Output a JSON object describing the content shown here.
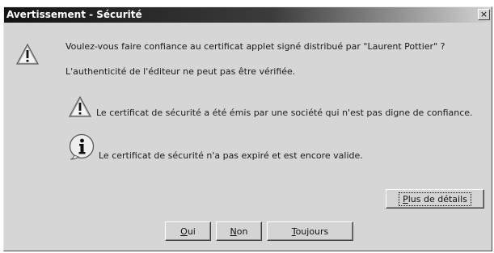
{
  "dialog": {
    "title": "Avertissement - Sécurité",
    "close_glyph": "×",
    "question": "Voulez-vous faire confiance au certificat applet signé distribué par \"Laurent Pottier\" ?",
    "publisher_warning": "L'authenticité de l'éditeur ne peut pas être vérifiée.",
    "untrusted_issuer": "Le certificat de sécurité a été émis par une société qui n'est pas digne de confiance.",
    "valid_certificate": "Le certificat de sécurité n'a pas expiré et est encore valide."
  },
  "buttons": {
    "details": {
      "mnemonic": "P",
      "rest": "lus de détails"
    },
    "yes": {
      "mnemonic": "O",
      "rest": "ui"
    },
    "no": {
      "mnemonic": "N",
      "rest": "on"
    },
    "always": {
      "mnemonic": "T",
      "rest": "oujours"
    }
  },
  "icons": {
    "main_warning": "warning-icon",
    "issuer_warning": "warning-icon",
    "validity_info": "info-icon"
  },
  "colors": {
    "dialog_background": "#d6d6d6",
    "titlebar_dark": "#141414",
    "titlebar_light": "#d4d4d4"
  }
}
